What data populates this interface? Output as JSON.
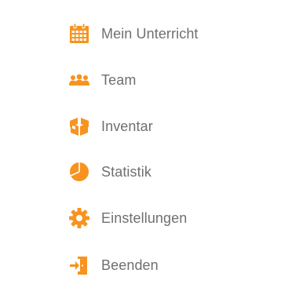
{
  "colors": {
    "accent": "#f7931e",
    "text": "#6f6f6f",
    "background": "#ffffff"
  },
  "menu": {
    "items": [
      {
        "label": "Mein Unterricht",
        "icon": "calendar-icon"
      },
      {
        "label": "Team",
        "icon": "team-icon"
      },
      {
        "label": "Inventar",
        "icon": "box-icon"
      },
      {
        "label": "Statistik",
        "icon": "pie-chart-icon"
      },
      {
        "label": "Einstellungen",
        "icon": "gear-icon"
      },
      {
        "label": "Beenden",
        "icon": "exit-icon"
      }
    ]
  }
}
